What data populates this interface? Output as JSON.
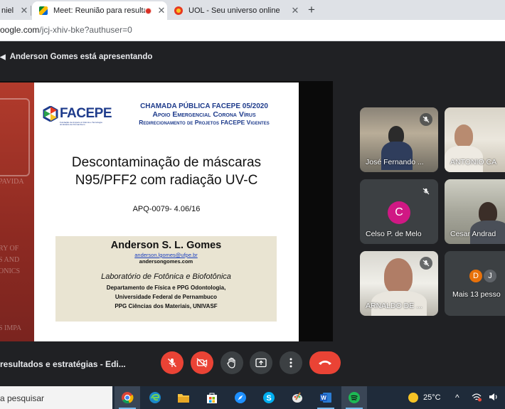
{
  "browser": {
    "tabs": [
      {
        "title": "niel",
        "active": false
      },
      {
        "title": "Meet: Reunião para resultad",
        "active": true,
        "recording": true
      },
      {
        "title": "UOL - Seu universo online",
        "active": false
      }
    ],
    "new_tab_label": "+",
    "url_host": "oogle.com",
    "url_path": "/jcj-xhiv-bke?authuser=0"
  },
  "meet": {
    "presenting_text": "Anderson Gomes está apresentando",
    "meeting_name": "resultados e estratégias - Edi...",
    "participants": [
      {
        "name": "José Fernando ...",
        "muted": true
      },
      {
        "name": "ANTONIO CA",
        "muted": false
      },
      {
        "name": "Celso P. de Melo",
        "muted": true,
        "initial": "C",
        "avatar_color": "#d01884"
      },
      {
        "name": "Cesar Andrad",
        "muted": false
      },
      {
        "name": "ARNALDO DE ...",
        "muted": true
      },
      {
        "name": "Mais 13 pesso",
        "muted": false,
        "initials": [
          "D",
          "J"
        ]
      }
    ]
  },
  "slide": {
    "logo_text": "FACEPE",
    "logo_sub": "Fundação de Amparo à Ciência e Tecnologia do Estado de Pernambuco",
    "call_line1": "CHAMADA PÚBLICA FACEPE 05/2020",
    "call_line2": "Apoio Emergencial Corona Vírus",
    "call_line3": "Redirecionamento de Projetos FACEPE Vigentes",
    "title_line1": "Descontaminação de máscaras",
    "title_line2": "N95/PFF2 com radiação UV-C",
    "apq": "APQ-0079- 4.06/16",
    "author": "Anderson S. L. Gomes",
    "email": "anderson.lgomes@ufpe.br",
    "website": "andersongomes.com",
    "lab": "Laboratório de Fotônica e Biofotônica",
    "dept1": "Departamento de Física e PPG Odontologia,",
    "dept2": "Universidade Federal de Pernambuco",
    "dept3": "PPG Ciências dos Materiais, UNIVASF",
    "side_fragments": [
      "PAVIDA",
      "RY OF",
      "S AND",
      "ONICS",
      "S IMPA"
    ]
  },
  "taskbar": {
    "search_text": "a pesquisar",
    "weather_temp": "25°C"
  }
}
